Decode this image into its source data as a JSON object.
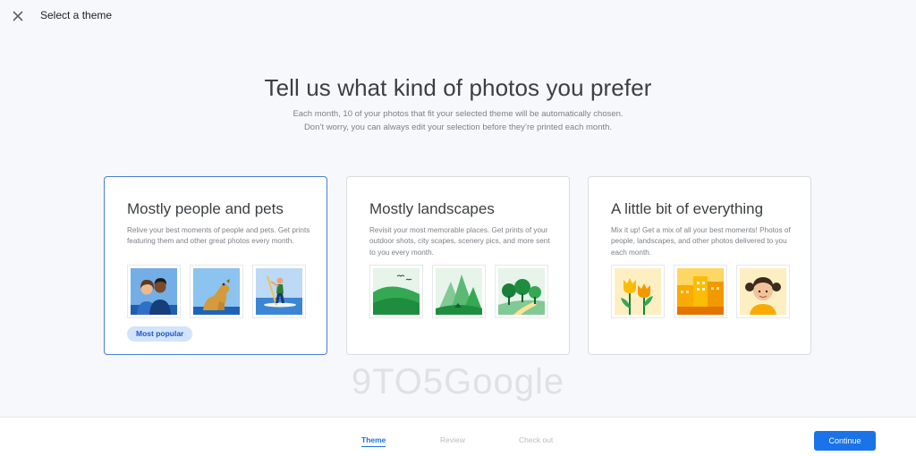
{
  "header": {
    "title": "Select a theme"
  },
  "main": {
    "headline": "Tell us what kind of photos you prefer",
    "subtitle_line1": "Each month, 10 of your photos that fit your selected theme will be automatically chosen.",
    "subtitle_line2": "Don’t worry, you can always edit your selection before they’re printed each month."
  },
  "themes": [
    {
      "title": "Mostly people and pets",
      "description": "Relive your best moments of people and pets. Get prints featuring them and other great photos every month.",
      "badge": "Most popular",
      "selected": true,
      "thumbnails": [
        "couple-photo",
        "dog-photo",
        "paddleboard-photo"
      ]
    },
    {
      "title": "Mostly landscapes",
      "description": "Revisit your most memorable places. Get prints of your outdoor shots, city scapes, scenery pics, and more sent to you every month.",
      "selected": false,
      "thumbnails": [
        "hills-photo",
        "mountains-photo",
        "trees-photo"
      ]
    },
    {
      "title": "A little bit of everything",
      "description": "Mix it up! Get a mix of all your best moments! Photos of people, landscapes, and other photos delivered to you each month.",
      "selected": false,
      "thumbnails": [
        "tulips-photo",
        "city-photo",
        "girl-photo"
      ]
    }
  ],
  "watermark": "9TO5Google",
  "footer": {
    "steps": [
      "Theme",
      "Review",
      "Check out"
    ],
    "active_step": "Theme",
    "continue_label": "Continue"
  },
  "colors": {
    "accent": "#1a73e8",
    "badge_bg": "#d2e3fc"
  }
}
